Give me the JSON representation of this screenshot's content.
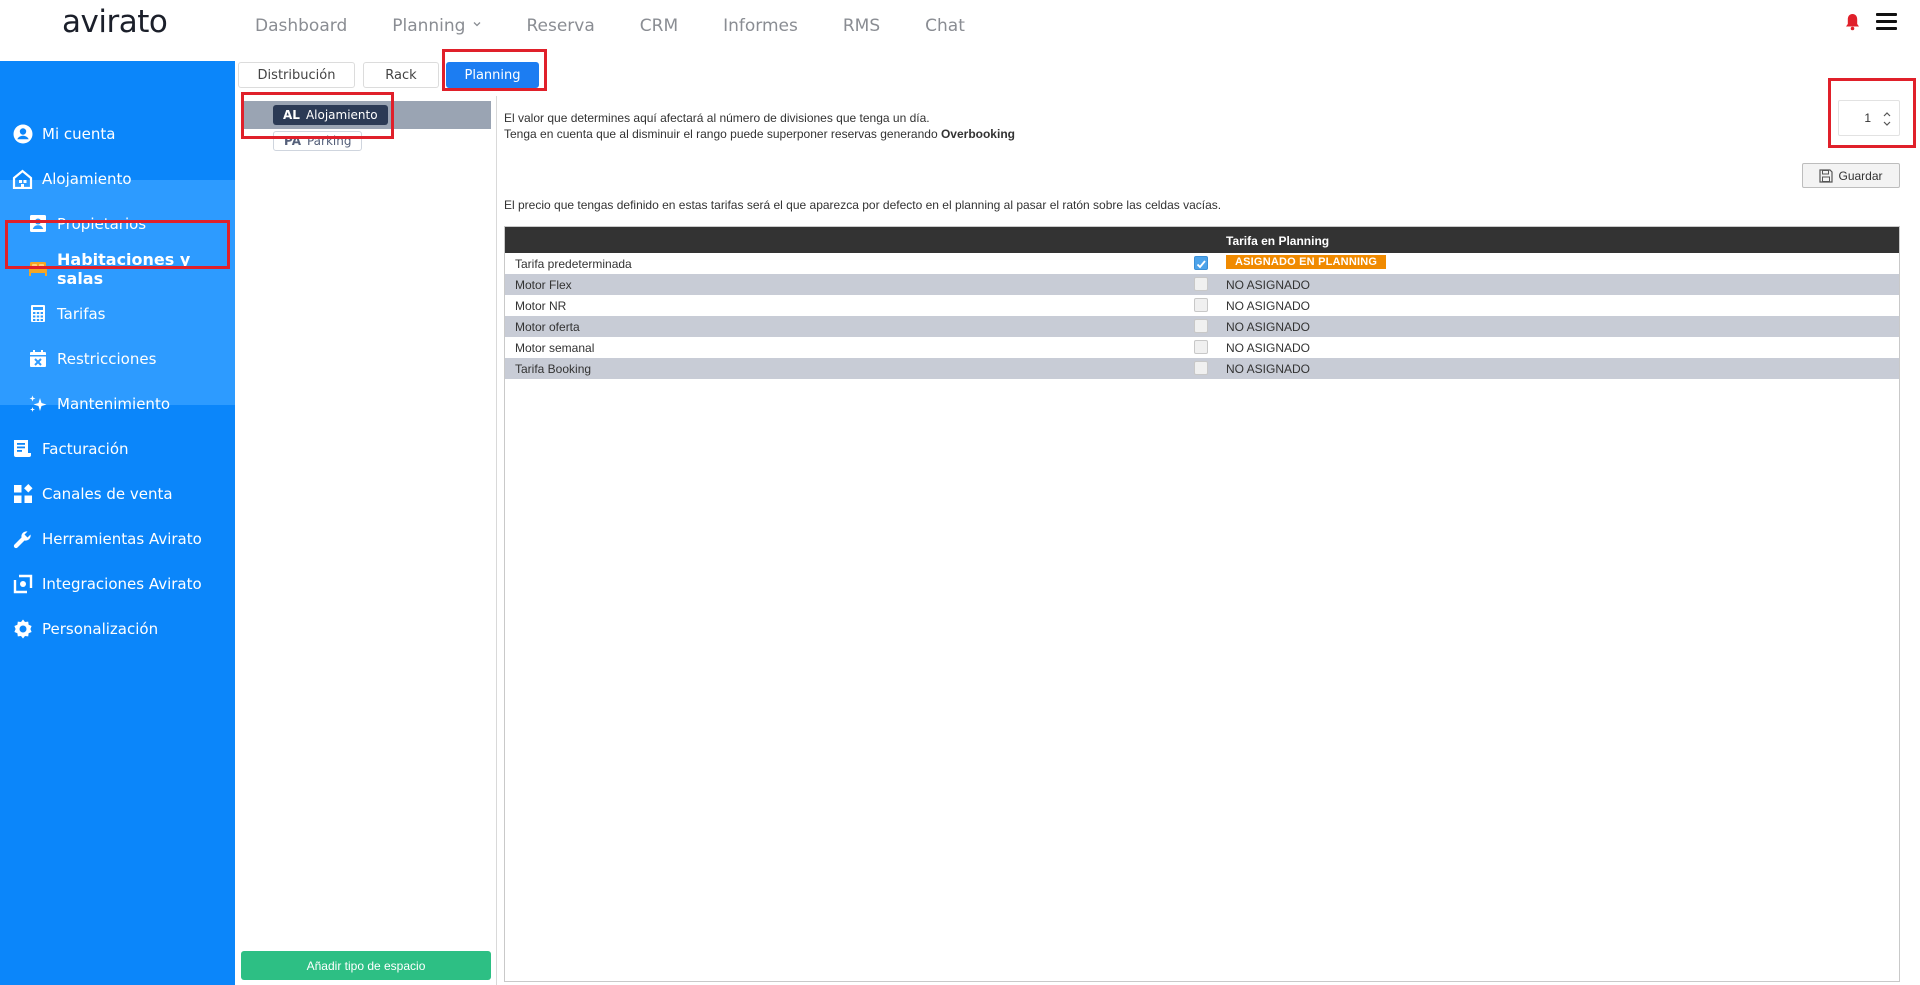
{
  "brand": {
    "logo_text": "avirato"
  },
  "topnav": {
    "items": [
      {
        "label": "Dashboard"
      },
      {
        "label": "Planning",
        "has_dropdown": true
      },
      {
        "label": "Reserva"
      },
      {
        "label": "CRM"
      },
      {
        "label": "Informes"
      },
      {
        "label": "RMS"
      },
      {
        "label": "Chat"
      }
    ]
  },
  "sidebar": {
    "items": [
      {
        "label": "Mi cuenta",
        "icon": "user-circle-icon"
      },
      {
        "label": "Alojamiento",
        "icon": "building-icon"
      },
      {
        "label": "Propietarios",
        "icon": "owner-card-icon"
      },
      {
        "label": "Habitaciones y salas",
        "icon": "bed-icon",
        "active": true
      },
      {
        "label": "Tarifas",
        "icon": "calculator-icon"
      },
      {
        "label": "Restricciones",
        "icon": "calendar-x-icon"
      },
      {
        "label": "Mantenimiento",
        "icon": "sparkles-icon"
      },
      {
        "label": "Facturación",
        "icon": "invoice-icon"
      },
      {
        "label": "Canales de venta",
        "icon": "channels-grid-icon"
      },
      {
        "label": "Herramientas Avirato",
        "icon": "wrench-icon"
      },
      {
        "label": "Integraciones Avirato",
        "icon": "integration-icon"
      },
      {
        "label": "Personalización",
        "icon": "customize-gear-icon"
      }
    ]
  },
  "tabs": [
    {
      "label": "Distribución"
    },
    {
      "label": "Rack"
    },
    {
      "label": "Planning",
      "active": true
    }
  ],
  "space_types": [
    {
      "code": "AL",
      "label": "Alojamiento",
      "selected": true
    },
    {
      "code": "PA",
      "label": "Parking",
      "selected": false
    }
  ],
  "add_space_button": "Añadir tipo de espacio",
  "info": {
    "line1": "El valor que determines aquí afectará al número de divisiones que tenga un día.",
    "line2_prefix": "Tenga en cuenta que al disminuir el rango puede superponer reservas generando ",
    "line2_bold": "Overbooking",
    "line3": "El precio que tengas definido en estas tarifas será el que aparezca por defecto en el planning al pasar el ratón sobre las celdas vacías."
  },
  "divisions_input": {
    "value": "1"
  },
  "save_button": "Guardar",
  "table": {
    "header": "Tarifa en Planning",
    "rows": [
      {
        "name": "Tarifa predeterminada",
        "checked": true,
        "status": "ASIGNADO EN PLANNING"
      },
      {
        "name": "Motor Flex",
        "checked": false,
        "status": "NO ASIGNADO"
      },
      {
        "name": "Motor NR",
        "checked": false,
        "status": "NO ASIGNADO"
      },
      {
        "name": "Motor oferta",
        "checked": false,
        "status": "NO ASIGNADO"
      },
      {
        "name": "Motor semanal",
        "checked": false,
        "status": "NO ASIGNADO"
      },
      {
        "name": "Tarifa Booking",
        "checked": false,
        "status": "NO ASIGNADO"
      }
    ]
  },
  "colors": {
    "sidebar_bg": "#0b86fa",
    "sidebar_sub_bg": "#2d9bff",
    "active_tab": "#1c7df2",
    "assigned_badge": "#f08a00",
    "add_button": "#2dbf84",
    "highlight": "#e0202a"
  }
}
